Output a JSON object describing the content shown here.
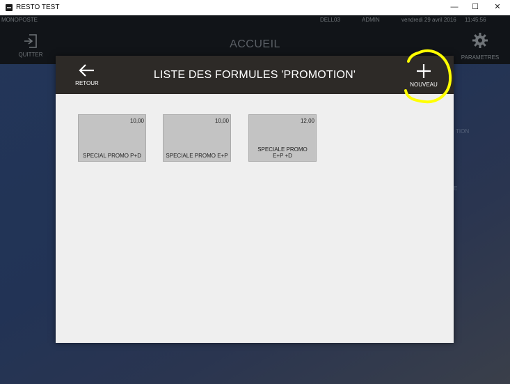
{
  "window": {
    "title": "RESTO TEST",
    "minimize_glyph": "—",
    "maximize_glyph": "☐",
    "close_glyph": "✕"
  },
  "app": {
    "mode": "MONOPOSTE",
    "machine": "DELL03",
    "user": "ADMIN",
    "date": "vendredi 29 avril 2016",
    "time": "11:45:56",
    "quit_label": "QUITTER",
    "page_title": "ACCUEIL",
    "params_label": "PARAMETRES",
    "bg_fragments": [
      "TION",
      "E"
    ]
  },
  "modal": {
    "title": "LISTE DES FORMULES 'PROMOTION'",
    "back_label": "RETOUR",
    "new_label": "NOUVEAU",
    "icons": {
      "back": "arrow-left-icon",
      "new": "plus-icon"
    },
    "formulas": [
      {
        "price": "10,00",
        "name": "SPECIAL PROMO P+D"
      },
      {
        "price": "10,00",
        "name": "SPECIALE PROMO E+P"
      },
      {
        "price": "12,00",
        "name": "SPECIALE PROMO E+P +D"
      }
    ]
  },
  "colors": {
    "header_bg": "#2d2a27",
    "modal_bg": "#efefef",
    "tile_bg": "#c3c3c3",
    "highlight": "#ffff00",
    "topbar_bg": "#111418"
  }
}
